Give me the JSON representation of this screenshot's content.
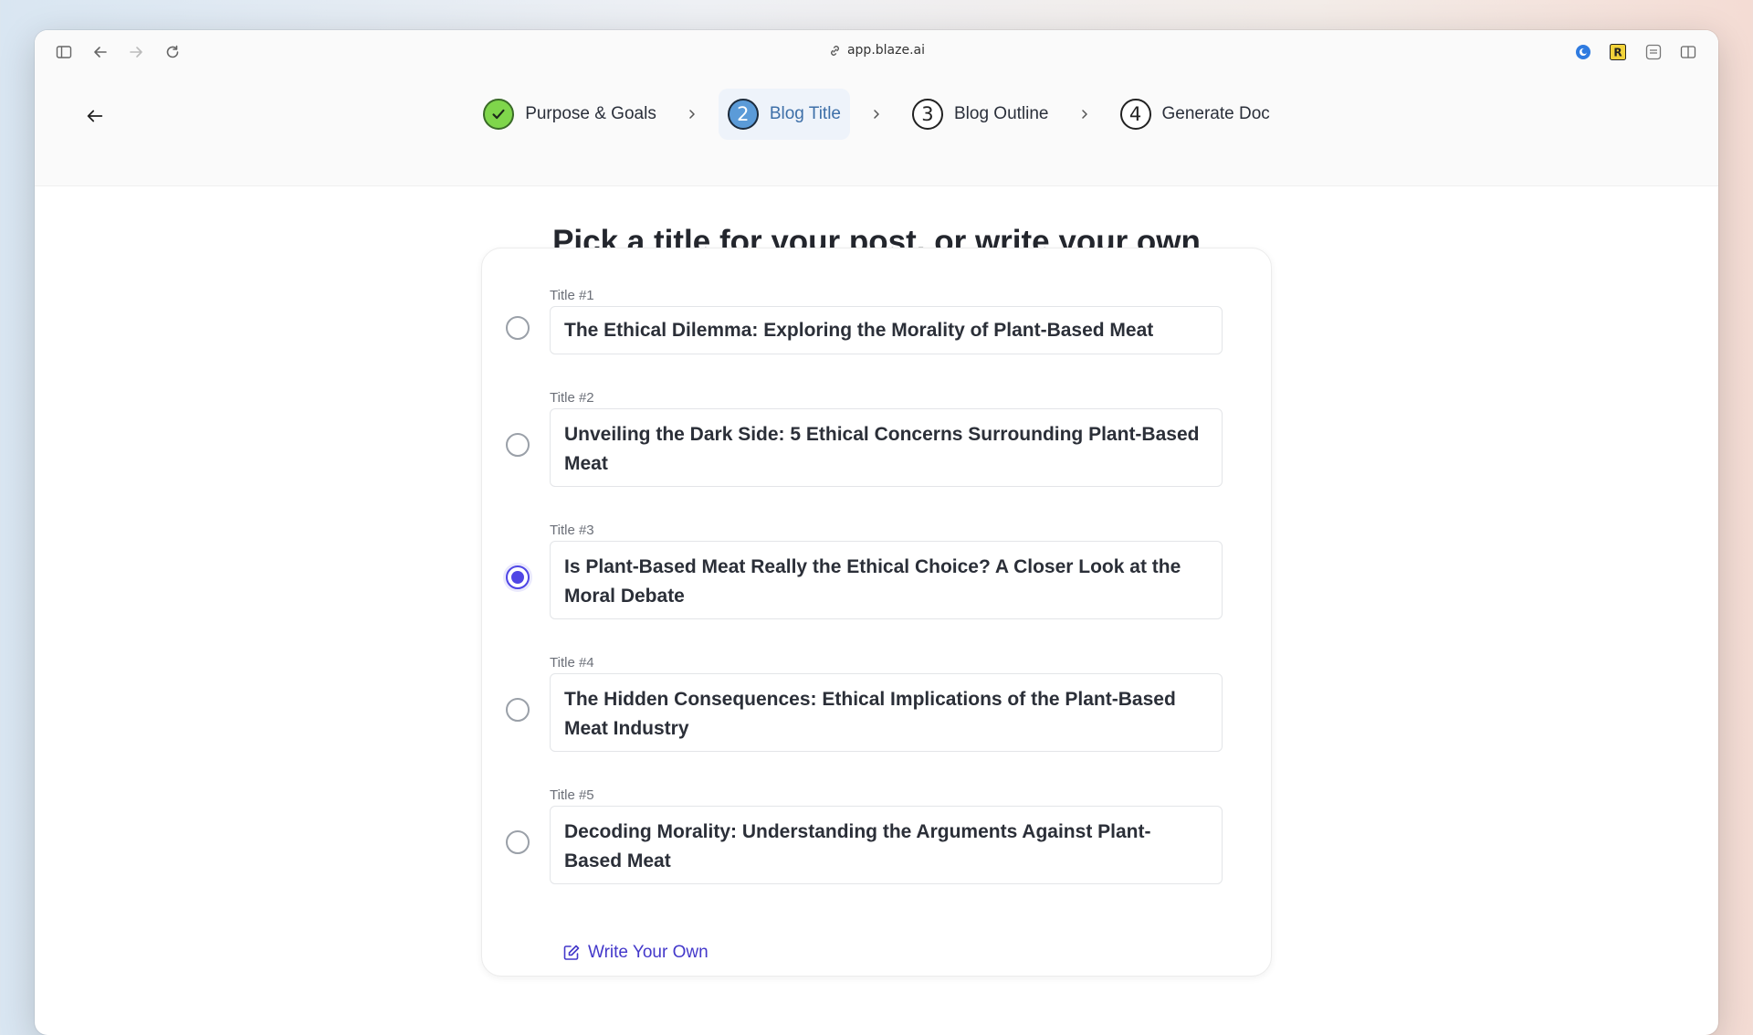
{
  "browser": {
    "url": "app.blaze.ai"
  },
  "stepper": {
    "steps": [
      {
        "badge": "✓",
        "label": "Purpose & Goals",
        "state": "done"
      },
      {
        "badge": "2",
        "label": "Blog Title",
        "state": "current"
      },
      {
        "badge": "3",
        "label": "Blog Outline",
        "state": "todo"
      },
      {
        "badge": "4",
        "label": "Generate Doc",
        "state": "todo"
      }
    ]
  },
  "page": {
    "heading": "Pick a title for your post, or write your own"
  },
  "titles": [
    {
      "label": "Title #1",
      "text": "The Ethical Dilemma: Exploring the Morality of Plant-Based Meat",
      "selected": false
    },
    {
      "label": "Title #2",
      "text": "Unveiling the Dark Side: 5 Ethical Concerns Surrounding Plant-Based Meat",
      "selected": false
    },
    {
      "label": "Title #3",
      "text": "Is Plant-Based Meat Really the Ethical Choice? A Closer Look at the Moral Debate",
      "selected": true
    },
    {
      "label": "Title #4",
      "text": "The Hidden Consequences: Ethical Implications of the Plant-Based Meat Industry",
      "selected": false
    },
    {
      "label": "Title #5",
      "text": "Decoding Morality: Understanding the Arguments Against Plant-Based Meat",
      "selected": false
    }
  ],
  "write_own": {
    "label": "Write Your Own"
  },
  "colors": {
    "accent": "#4f46e5",
    "step_done": "#7fd64b",
    "step_current": "#5b9bd8"
  }
}
